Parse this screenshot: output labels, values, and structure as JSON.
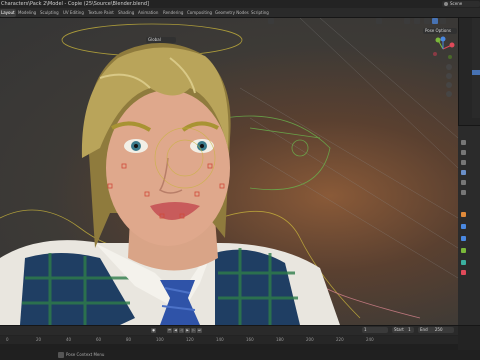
{
  "window": {
    "title": "Characters\\Pack 2\\Model - Copie (25\\Source\\Blender.blend]",
    "scene_label": "Scene"
  },
  "workspace_tabs": [
    {
      "label": "Layout",
      "active": true
    },
    {
      "label": "Modeling",
      "active": false
    },
    {
      "label": "Sculpting",
      "active": false
    },
    {
      "label": "UV Editing",
      "active": false
    },
    {
      "label": "Texture Paint",
      "active": false
    },
    {
      "label": "Shading",
      "active": false
    },
    {
      "label": "Animation",
      "active": false
    },
    {
      "label": "Rendering",
      "active": false
    },
    {
      "label": "Compositing",
      "active": false
    },
    {
      "label": "Geometry Nodes",
      "active": false
    },
    {
      "label": "Scripting",
      "active": false
    }
  ],
  "viewport": {
    "mode": "Global",
    "pose_options": "Pose Options"
  },
  "timeline": {
    "current_frame": "1",
    "start_label": "Start",
    "start_value": "1",
    "end_label": "End",
    "end_value": "250",
    "ruler_ticks": [
      "0",
      "20",
      "40",
      "60",
      "80",
      "100",
      "120",
      "140",
      "160",
      "180",
      "200",
      "220",
      "240"
    ]
  },
  "status_bar": {
    "text": "Pose Context Menu"
  },
  "colors": {
    "accent": "#4772b3",
    "rig_yellow": "#c8b43c",
    "rig_green": "#6ab04c",
    "rig_pink": "#d0808a",
    "axis_x": "#e04a5a",
    "axis_y": "#7ab83a",
    "axis_z": "#4a88e0"
  }
}
